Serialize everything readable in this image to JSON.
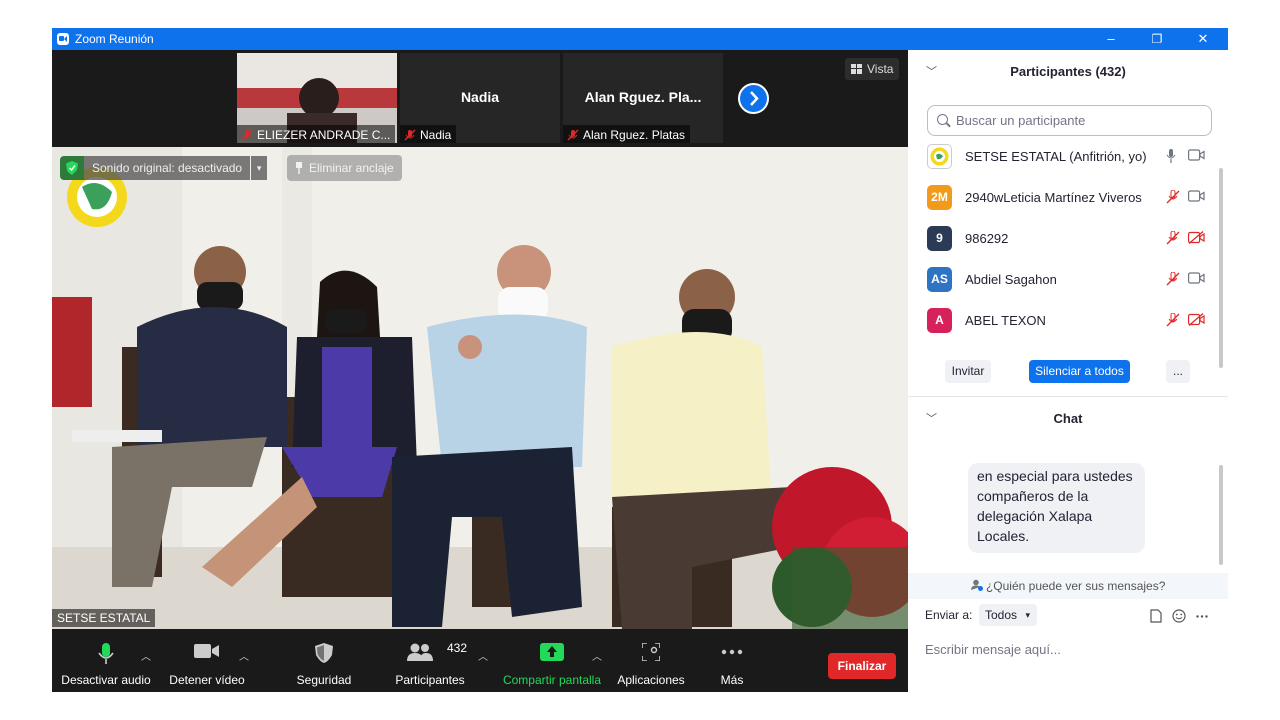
{
  "window": {
    "title": "Zoom Reunión",
    "minimize": "–",
    "restore": "❐",
    "close": "✕"
  },
  "strip": {
    "tiles": [
      {
        "label": "ELIEZER ANDRADE C..."
      },
      {
        "center_name": "Nadia",
        "label": "Nadia"
      },
      {
        "center_name": "Alan  Rguez. Pla...",
        "label": "Alan  Rguez. Platas"
      }
    ],
    "view_label": "Vista"
  },
  "main": {
    "original_sound": "Sonido original: desactivado",
    "unpin": "Eliminar anclaje",
    "speaker": "SETSE ESTATAL"
  },
  "toolbar": {
    "audio": "Desactivar audio",
    "video": "Detener vídeo",
    "security": "Seguridad",
    "participants": "Participantes",
    "participants_count": "432",
    "share": "Compartir pantalla",
    "apps": "Aplicaciones",
    "more": "Más",
    "end": "Finalizar"
  },
  "participants_panel": {
    "title": "Participantes (432)",
    "search_placeholder": "Buscar un participante",
    "rows": [
      {
        "initials": "",
        "name": "SETSE ESTATAL (Anfitrión, yo)",
        "color": "#ffffff",
        "mic": "on",
        "cam": "on"
      },
      {
        "initials": "2M",
        "name": "2940wLeticia Martínez Viveros",
        "color": "#f29a1a",
        "mic": "off",
        "cam": "on"
      },
      {
        "initials": "9",
        "name": "986292",
        "color": "#2b3a55",
        "mic": "off",
        "cam": "off"
      },
      {
        "initials": "AS",
        "name": "Abdiel Sagahon",
        "color": "#2d74c4",
        "mic": "off",
        "cam": "on"
      },
      {
        "initials": "A",
        "name": "ABEL TEXON",
        "color": "#d6215a",
        "mic": "off",
        "cam": "off"
      }
    ],
    "invite": "Invitar",
    "mute_all": "Silenciar a todos",
    "more": "..."
  },
  "chat_panel": {
    "title": "Chat",
    "message": "en especial para ustedes compañeros de la delegación Xalapa Locales.",
    "who_can_see": "¿Quién puede ver sus mensajes?",
    "send_to_label": "Enviar a:",
    "send_to_value": "Todos",
    "input_placeholder": "Escribir mensaje aquí..."
  },
  "colors": {
    "accent": "#0e72ed",
    "end": "#e02828",
    "muted": "#e02828",
    "share": "#23d959"
  }
}
